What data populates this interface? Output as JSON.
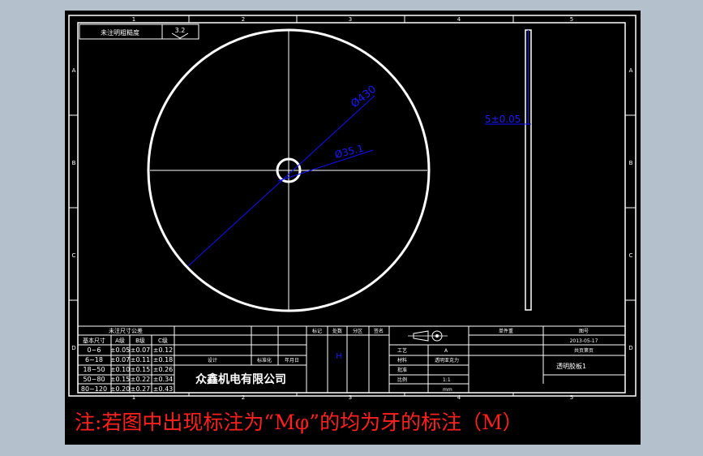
{
  "drawing": {
    "roughness_note": "未注明粗糙度",
    "roughness_value": "3.2",
    "dim_outer": "Ø430",
    "dim_inner": "Ø35.1",
    "dim_thickness": "5±0.05",
    "col_numbers": [
      "1",
      "2",
      "3",
      "4",
      "5"
    ],
    "row_letters": [
      "A",
      "B",
      "C",
      "D"
    ]
  },
  "tolerance_table": {
    "title": "未注尺寸公差",
    "headers": [
      "基本尺寸",
      "A级",
      "B级",
      "C级"
    ],
    "rows": [
      [
        "0~6",
        "±0.05",
        "±0.07",
        "±0.12"
      ],
      [
        "6~18",
        "±0.07",
        "±0.11",
        "±0.18"
      ],
      [
        "18~50",
        "±0.10",
        "±0.15",
        "±0.26"
      ],
      [
        "50~80",
        "±0.15",
        "±0.22",
        "±0.34"
      ],
      [
        "80~120",
        "±0.20",
        "±0.27",
        "±0.43"
      ]
    ]
  },
  "title_block": {
    "company": "众鑫机电有限公司",
    "rev_headers": [
      "标记",
      "处数",
      "分区",
      "更改文件号",
      "签名",
      "年月日"
    ],
    "design_label": "设计",
    "drawn_label": "标准化",
    "process_label": "工艺",
    "approve_label": "批准",
    "material_label": "材料",
    "scale_label": "比例",
    "scale_value": "1:1",
    "unit_value": "mm",
    "grade": "A",
    "material_value": "透明亚克力",
    "mark_h": "H",
    "part_name": "透明胶板1",
    "date": "2013-05-17",
    "drawing_no_label": "图号",
    "sheet_label": "共页第页",
    "col_headers": [
      "单件重",
      "阶段标记",
      "重量",
      "比例"
    ]
  },
  "note": "注:若图中出现标注为“Mφ”的均为牙的标注（M）"
}
